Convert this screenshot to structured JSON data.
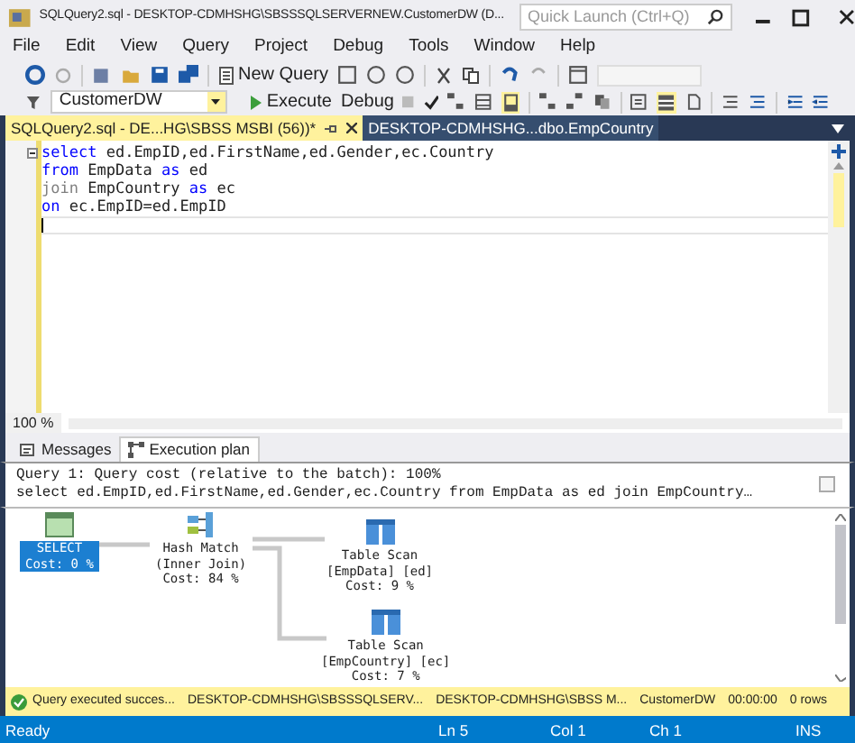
{
  "window": {
    "title": "SQLQuery2.sql - DESKTOP-CDMHSHG\\SBSSSQLSERVERNEW.CustomerDW (D...",
    "quick_launch": {
      "placeholder": "Quick Launch (Ctrl+Q)"
    }
  },
  "menu": [
    "File",
    "Edit",
    "View",
    "Query",
    "Project",
    "Debug",
    "Tools",
    "Window",
    "Help"
  ],
  "toolbar": {
    "new_query": "New Query",
    "database": "CustomerDW",
    "execute": "Execute",
    "debug": "Debug"
  },
  "doc_tabs": [
    {
      "label": "SQLQuery2.sql - DE...HG\\SBSS MSBI (56))*",
      "selected": true
    },
    {
      "label": "DESKTOP-CDMHSHG...dbo.EmpCountry",
      "selected": false
    }
  ],
  "editor": {
    "lines": [
      [
        {
          "kind": "keyword",
          "text": "select"
        },
        {
          "kind": "plain",
          "text": " ed.EmpID,ed.FirstName,ed.Gender,ec.Country"
        }
      ],
      [
        {
          "kind": "keyword",
          "text": "from"
        },
        {
          "kind": "plain",
          "text": " EmpData "
        },
        {
          "kind": "keyword",
          "text": "as"
        },
        {
          "kind": "plain",
          "text": " ed"
        }
      ],
      [
        {
          "kind": "operator",
          "text": "join"
        },
        {
          "kind": "plain",
          "text": " EmpCountry "
        },
        {
          "kind": "keyword",
          "text": "as"
        },
        {
          "kind": "plain",
          "text": " ec"
        }
      ],
      [
        {
          "kind": "keyword",
          "text": "on"
        },
        {
          "kind": "plain",
          "text": " ec.EmpID=ed.EmpID"
        }
      ]
    ],
    "zoom": "100 %"
  },
  "results_tabs": [
    {
      "label": "Messages",
      "selected": false
    },
    {
      "label": "Execution plan",
      "selected": true
    }
  ],
  "plan": {
    "header": [
      "Query 1: Query cost (relative to the batch): 100%",
      "select ed.EmpID,ed.FirstName,ed.Gender,ec.Country from EmpData as ed join EmpCountry…"
    ],
    "nodes": [
      {
        "kind": "select",
        "lines": [
          "SELECT",
          "Cost: 0 %"
        ],
        "selected": true
      },
      {
        "kind": "hash",
        "lines": [
          "Hash Match",
          "(Inner Join)",
          "Cost: 84 %"
        ],
        "selected": false
      },
      {
        "kind": "scan",
        "lines": [
          "Table Scan",
          "[EmpData] [ed]",
          "Cost: 9 %"
        ],
        "selected": false
      },
      {
        "kind": "scan",
        "lines": [
          "Table Scan",
          "[EmpCountry] [ec]",
          "Cost: 7 %"
        ],
        "selected": false
      }
    ]
  },
  "status_strip": {
    "message": "Query executed succes...",
    "server": "DESKTOP-CDMHSHG\\SBSSSQLSERV...",
    "login": "DESKTOP-CDMHSHG\\SBSS M...",
    "database": "CustomerDW",
    "time": "00:00:00",
    "rows": "0 rows"
  },
  "status_bar": {
    "state": "Ready",
    "line": "Ln 5",
    "column": "Col 1",
    "char": "Ch 1",
    "mode": "INS"
  }
}
